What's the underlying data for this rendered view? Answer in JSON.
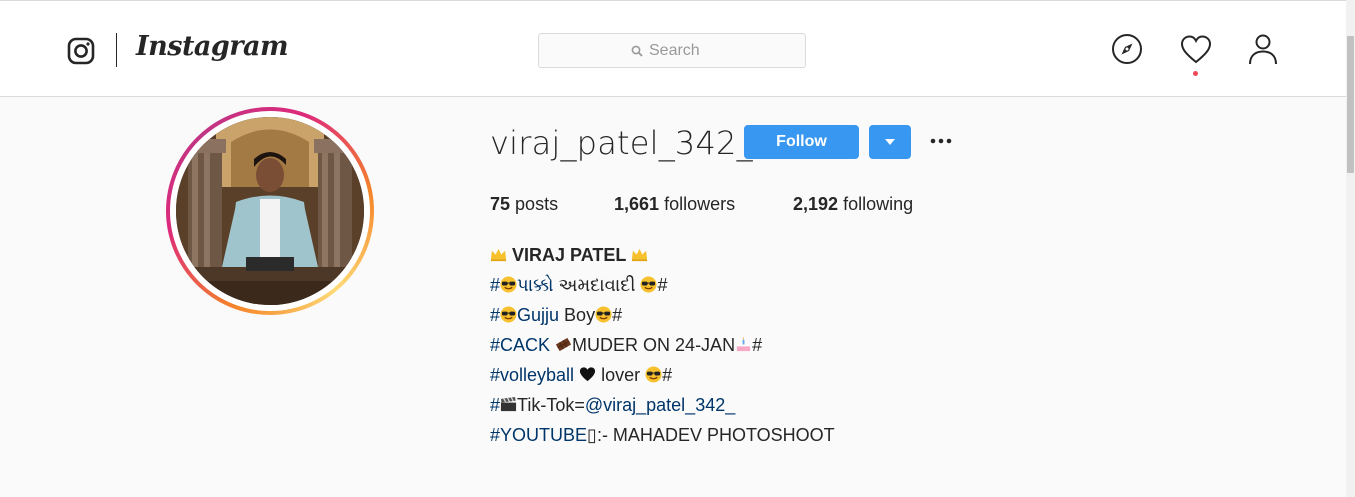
{
  "header": {
    "logo_text": "Instagram",
    "search_placeholder": "Search",
    "icons": [
      "instagram-glyph-icon",
      "compass-icon",
      "heart-icon",
      "user-icon",
      "search-icon"
    ],
    "notification_dot_color": "#ed4956"
  },
  "profile": {
    "username": "viraj_patel_342_",
    "follow_label": "Follow",
    "stats": {
      "posts_count": "75",
      "posts_label": "posts",
      "followers_count": "1,661",
      "followers_label": "followers",
      "following_count": "2,192",
      "following_label": "following"
    },
    "bio": {
      "name": "VIRAJ PATEL",
      "line1_hash_prefix": "#",
      "line1_tag": "પાક્કો",
      "line1_text": " અમદાવાદી ",
      "line1_suffix": "#",
      "line2_hash_prefix": "#",
      "line2_tag": "Gujju",
      "line2_text": " Boy",
      "line2_suffix": "#",
      "line3_tag": "#CACK",
      "line3_text": "MUDER ON 24-JAN",
      "line3_suffix": "#",
      "line4_tag": "#volleyball",
      "line4_text": " lover ",
      "line4_suffix": "#",
      "line5_hash_prefix": "#",
      "line5_text": "Tik-Tok=",
      "line5_mention": "@viraj_patel_342_",
      "line6_tag": "#YOUTUBE",
      "line6_box": "▯",
      "line6_text": ":- MAHADEV PHOTOSHOOT"
    }
  },
  "colors": {
    "accent_blue": "#3897f0",
    "link_blue": "#003569",
    "text": "#262626",
    "ring_gradient": [
      "#f58529",
      "#dd2a7b",
      "#c13584"
    ]
  }
}
